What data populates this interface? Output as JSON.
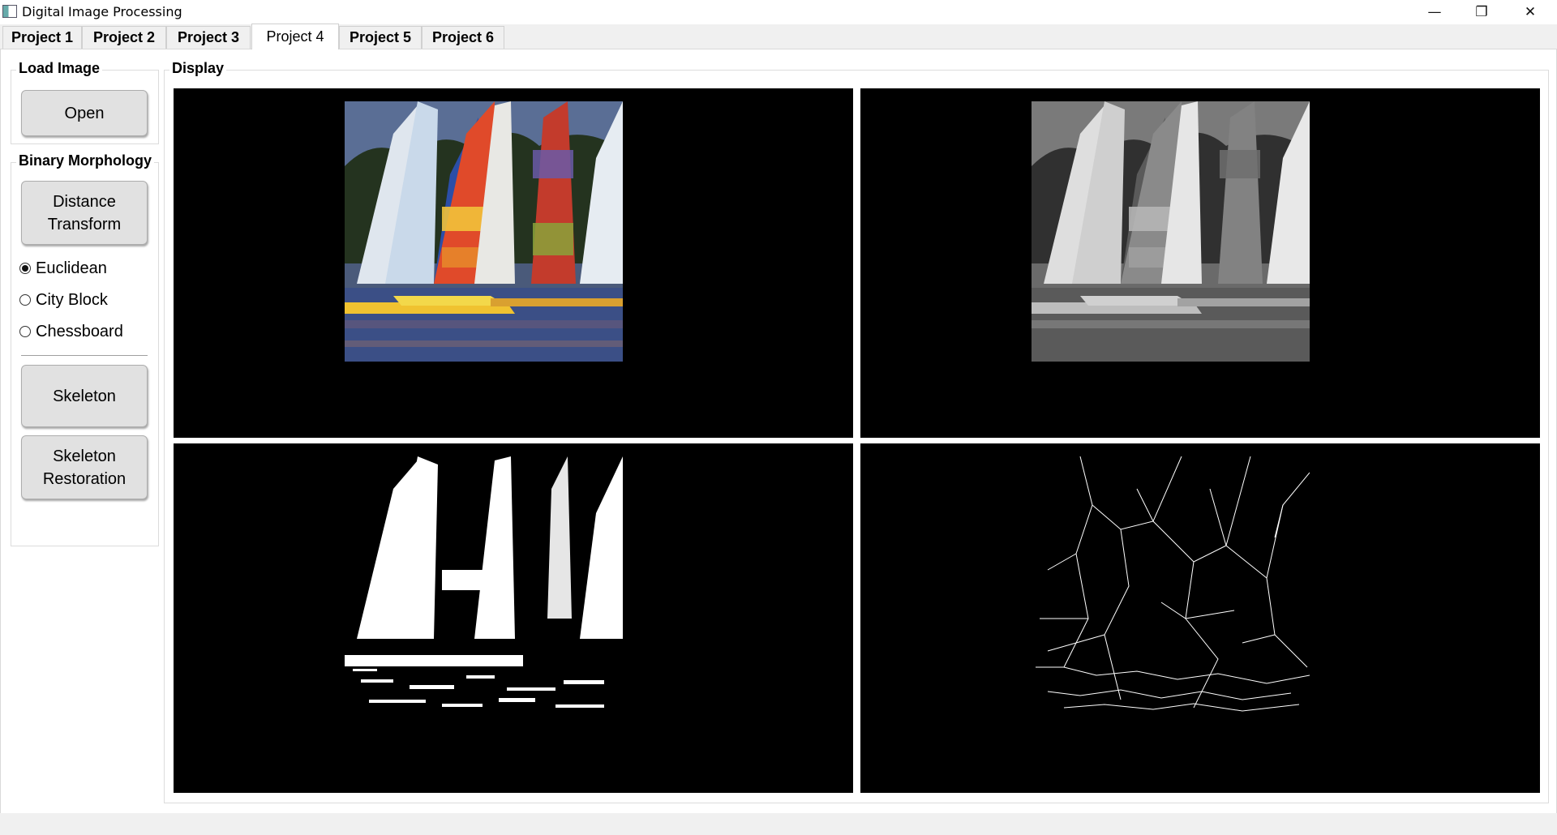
{
  "window": {
    "title": "Digital Image Processing",
    "minimize_glyph": "—",
    "restore_glyph": "❐",
    "close_glyph": "✕"
  },
  "tabs": [
    {
      "label": "Project 1"
    },
    {
      "label": "Project 2"
    },
    {
      "label": "Project 3"
    },
    {
      "label": "Project 4",
      "active": true
    },
    {
      "label": "Project 5"
    },
    {
      "label": "Project 6"
    }
  ],
  "load_image": {
    "title": "Load Image",
    "open_label": "Open"
  },
  "binary_morphology": {
    "title": "Binary Morphology",
    "distance_transform_label": "Distance\nTransform",
    "radios": [
      {
        "label": "Euclidean",
        "checked": true
      },
      {
        "label": "City Block",
        "checked": false
      },
      {
        "label": "Chessboard",
        "checked": false
      }
    ],
    "skeleton_label": "Skeleton",
    "skeleton_restoration_label": "Skeleton\nRestoration"
  },
  "display": {
    "title": "Display",
    "panel_content": [
      "color-sailboats-image",
      "grayscale-sailboats-image",
      "binary-sailboats-image",
      "skeleton-sailboats-image"
    ]
  },
  "colors": {
    "panel_bg": "#000000",
    "window_bg": "#f0f0f0",
    "button_bg": "#e1e1e1"
  }
}
